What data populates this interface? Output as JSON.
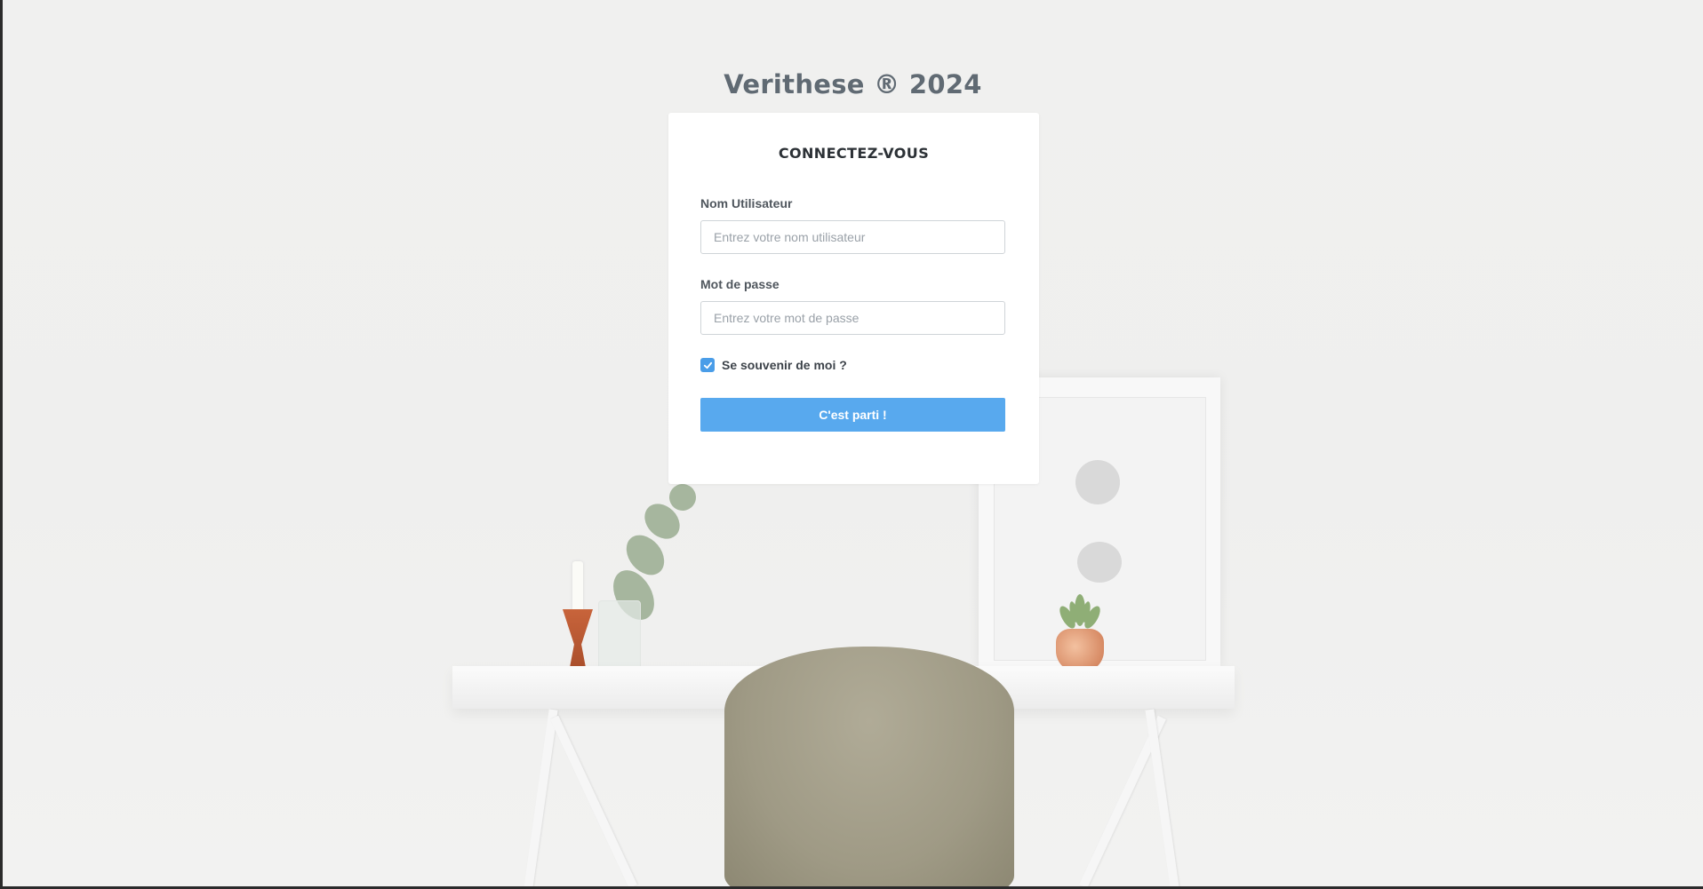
{
  "brand": {
    "title": "Verithese ® 2024"
  },
  "login": {
    "heading": "CONNECTEZ-VOUS",
    "username": {
      "label": "Nom Utilisateur",
      "value": "",
      "placeholder": "Entrez votre nom utilisateur"
    },
    "password": {
      "label": "Mot de passe",
      "value": "",
      "placeholder": "Entrez votre mot de passe"
    },
    "remember": {
      "label": "Se souvenir de moi ?",
      "checked": true
    },
    "submit_label": "C'est parti !"
  },
  "colors": {
    "accent": "#58a9ee",
    "checkbox": "#4a9de8",
    "brand_text": "#606a73",
    "card_background": "#ffffff"
  },
  "icons": {
    "checkbox": "check-icon"
  }
}
